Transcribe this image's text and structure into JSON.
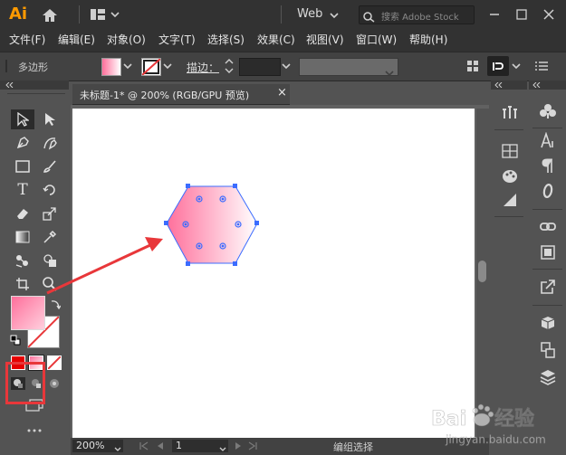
{
  "titlebar": {
    "app_logo": "Ai",
    "workspace": "Web",
    "search_placeholder": "搜索 Adobe Stock"
  },
  "menu": [
    "文件(F)",
    "编辑(E)",
    "对象(O)",
    "文字(T)",
    "选择(S)",
    "效果(C)",
    "视图(V)",
    "窗口(W)",
    "帮助(H)"
  ],
  "controlbar": {
    "selection_type": "多边形",
    "stroke_label": "描边："
  },
  "document": {
    "tab_title": "未标题-1* @ 200% (RGB/GPU 预览)",
    "close_glyph": "×"
  },
  "status": {
    "zoom": "200%",
    "artboard_number": "1",
    "tool_status": "编组选择"
  },
  "colors": {
    "ui_dark": "#323232",
    "panel": "#535353",
    "fill_gradient_start": "#ff6f9b",
    "fill_gradient_end": "#ffffff",
    "selection_blue": "#3b6cff",
    "annotation_red": "#e8373a"
  },
  "watermark": {
    "brand": "Bai du 经验",
    "url": "jingyan.baidu.com"
  }
}
